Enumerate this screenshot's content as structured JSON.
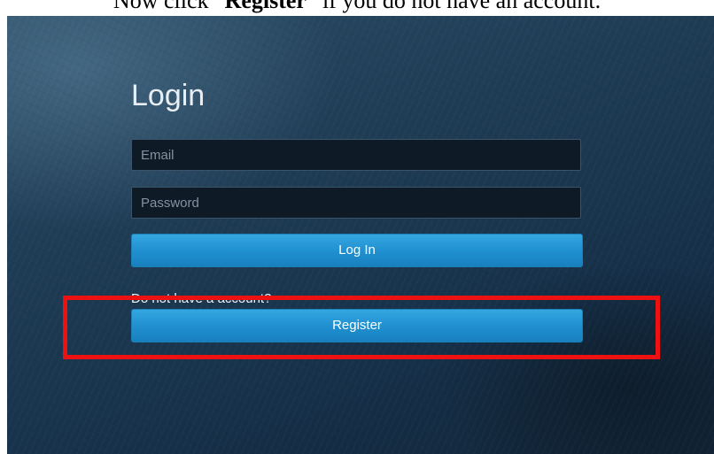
{
  "instruction": {
    "prefix": "Now click “",
    "emphasis": "Register",
    "suffix": "” if you do not have an account."
  },
  "login_form": {
    "title": "Login",
    "email_placeholder": "Email",
    "password_placeholder": "Password",
    "login_button_label": "Log In",
    "no_account_text": "Do not have a account?",
    "register_button_label": "Register"
  },
  "colors": {
    "highlight": "#ee1111",
    "button": "#1f8fcf",
    "background": "#1f3d55"
  }
}
